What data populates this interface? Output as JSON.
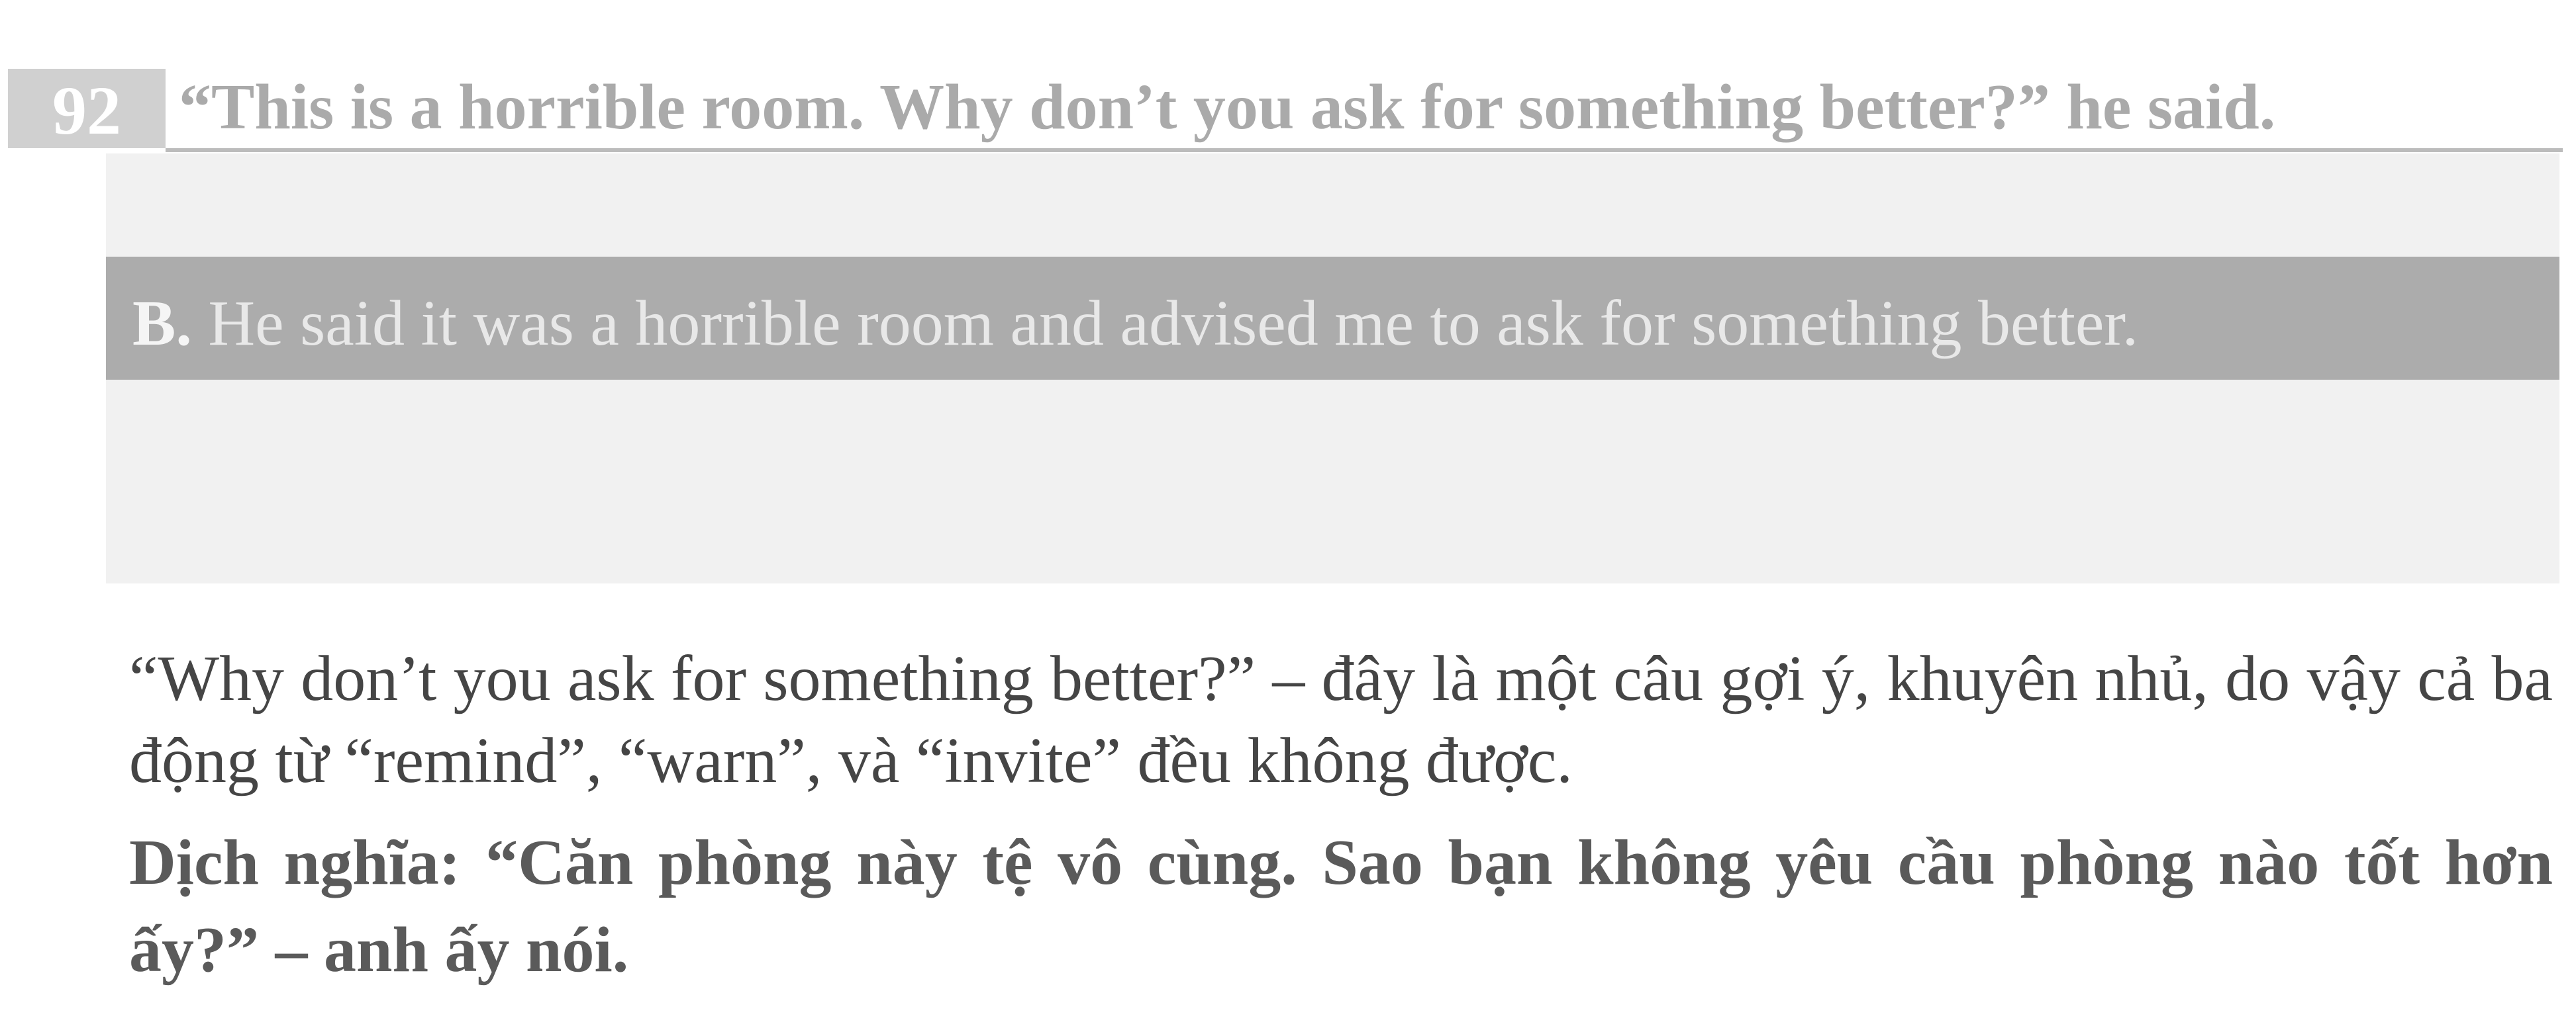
{
  "question": {
    "number": "92",
    "text": "“This is a horrible room. Why don’t you ask for something better?” he said."
  },
  "answer": {
    "option_label": "B.",
    "text": "He said it was a horrible room and advised me to ask for something better."
  },
  "explanation": {
    "text": "“Why don’t you ask for something better?” – đây là một câu gợi ý, khuyên nhủ, do vậy cả ba động từ “remind”, “warn”, và “invite” đều không được."
  },
  "translation": {
    "text": "Dịch nghĩa: “Căn phòng này tệ vô cùng. Sao bạn không yêu cầu phòng nào tốt hơn ấy?” – anh ấy nói."
  },
  "colors": {
    "question_badge": "#d0d0d0",
    "question_text": "#aaaaaa",
    "answer_band": "#acacac",
    "body_text": "#454545"
  }
}
